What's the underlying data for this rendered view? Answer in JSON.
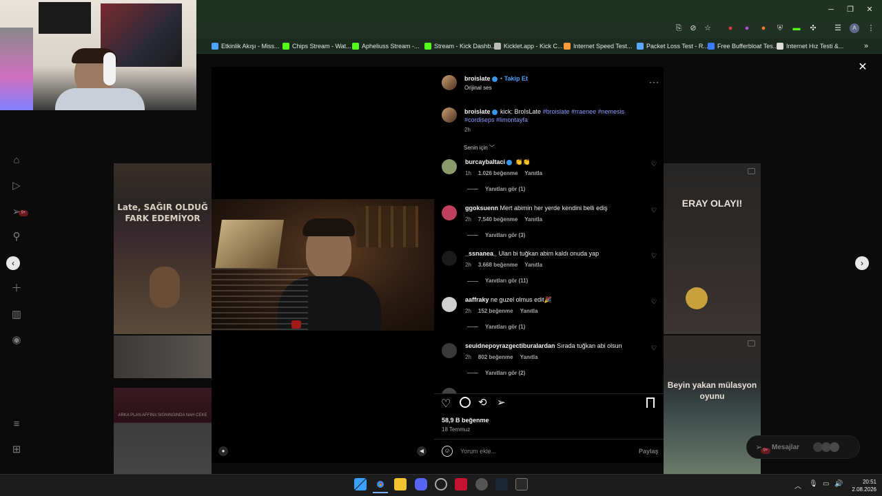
{
  "bookmarks": [
    {
      "label": "Etkinlik Akışı - Miss...",
      "color": "#4aa3ff"
    },
    {
      "label": "Chips Stream - Wat...",
      "color": "#53fc18"
    },
    {
      "label": "Apheliuss Stream -...",
      "color": "#53fc18"
    },
    {
      "label": "Stream - Kick Dashb...",
      "color": "#53fc18"
    },
    {
      "label": "Kicklet.app - Kick C...",
      "color": "#bbbbbb"
    },
    {
      "label": "Internet Speed Test...",
      "color": "#ff9a3c"
    },
    {
      "label": "Packet Loss Test - R...",
      "color": "#5aa9ff"
    },
    {
      "label": "Free Bufferbloat Tes...",
      "color": "#3a7bff"
    },
    {
      "label": "Internet Hız Testi &...",
      "color": "#dddddd"
    }
  ],
  "post": {
    "author": "broislate",
    "follow": "Takip Et",
    "audio": "Orijinal ses",
    "more_icon": "more-icon",
    "caption_user": "broislate",
    "caption_text": "kick: BroIsLate",
    "tags_line1": "#broislate #rraenee #nemesis",
    "tags_line2": "#cordiseps #limontayfa",
    "caption_time": "2h",
    "sort_label": "Senin için",
    "likes": "58,9 B beğenme",
    "date": "18 Temmuz",
    "comment_placeholder": "Yorum ekle...",
    "share": "Paylaş"
  },
  "comments": [
    {
      "user": "burcaybaltaci",
      "verified": true,
      "text": "👏👏",
      "time": "1h",
      "likes": "1.026 beğenme",
      "reply": "Yanıtla",
      "see": "Yanıtları gör (1)"
    },
    {
      "user": "ggoksuenn",
      "verified": false,
      "text": "Mert abimin her yerde kendini belli ediş",
      "time": "2h",
      "likes": "7.540 beğenme",
      "reply": "Yanıtla",
      "see": "Yanıtları gör (3)"
    },
    {
      "user": "_ssnanea_",
      "verified": false,
      "text": "Ulan bi tuğkan abim kaldı onuda yap",
      "time": "2h",
      "likes": "3.668 beğenme",
      "reply": "Yanıtla",
      "see": "Yanıtları gör (11)"
    },
    {
      "user": "aaffraky",
      "verified": false,
      "text": "ne guzel olmus edit🎉",
      "time": "2h",
      "likes": "152 beğenme",
      "reply": "Yanıtla",
      "see": "Yanıtları gör (1)"
    },
    {
      "user": "seuidnepoyrazgectiburalardan",
      "verified": false,
      "text": "Sırada tuğkan abi olsun",
      "time": "2h",
      "likes": "802 beğenme",
      "reply": "Yanıtla",
      "see": "Yanıtları gör (2)"
    }
  ],
  "background": {
    "thumb1_text": "Late, SAĞIR OLDUĞ FARK EDEMİYOR",
    "thumb2_text": "ERAY OLAYI!",
    "thumb3_text": "Beyin yakan mülasyon oyunu",
    "thumb4_text": "ARKA PLAN AFFINA SIGNINGINDA NAH CEKE",
    "messages": "Mesajlar",
    "messages_badge": "9+",
    "notif_badge": "9+"
  },
  "taskbar": {
    "time": "20:51",
    "date": "2.08.2026"
  },
  "colors": {
    "accent": "#3897f0",
    "tag": "#8a9cff",
    "chrome": "#203224"
  }
}
